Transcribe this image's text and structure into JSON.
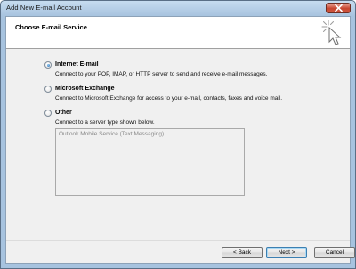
{
  "window": {
    "title": "Add New E-mail Account"
  },
  "header": {
    "title": "Choose E-mail Service"
  },
  "options": [
    {
      "label": "Internet E-mail",
      "description": "Connect to your POP, IMAP, or HTTP server to send and receive e-mail messages.",
      "selected": true
    },
    {
      "label": "Microsoft Exchange",
      "description": "Connect to Microsoft Exchange for access to your e-mail, contacts, faxes and voice mail.",
      "selected": false
    },
    {
      "label": "Other",
      "description": "Connect to a server type shown below.",
      "selected": false
    }
  ],
  "server_types": [
    "Outlook Mobile Service (Text Messaging)"
  ],
  "buttons": {
    "back": "< Back",
    "next": "Next >",
    "cancel": "Cancel"
  },
  "icons": {
    "close": "close-icon",
    "wizard": "wizard-cursor-icon"
  },
  "colors": {
    "titlebar": "#b4cde6",
    "close_button": "#c7452f",
    "dialog_bg": "#f0f0f0",
    "header_bg": "#ffffff"
  }
}
